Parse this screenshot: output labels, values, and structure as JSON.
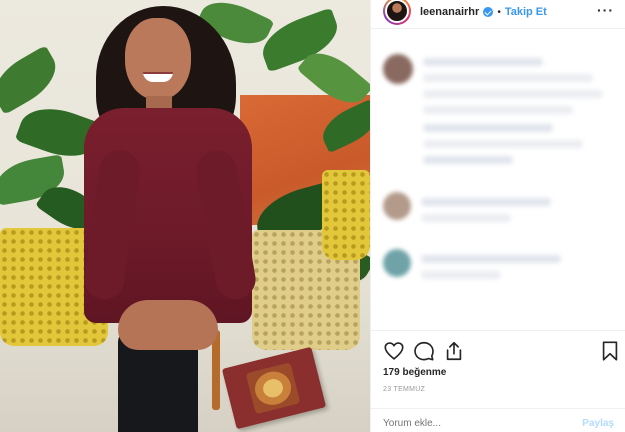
{
  "post": {
    "username": "leenanairhr",
    "verified": true,
    "separator": "•",
    "follow_label": "Takip Et",
    "more_icon": "more-horizontal-icon",
    "likes_text": "179 beğenme",
    "date_text": "23 TEMMUZ",
    "comment_placeholder": "Yorum ekle...",
    "post_label": "Paylaş"
  },
  "actions": [
    {
      "name": "like",
      "icon": "heart-icon"
    },
    {
      "name": "comment",
      "icon": "comment-bubble-icon"
    },
    {
      "name": "share",
      "icon": "share-icon"
    },
    {
      "name": "save",
      "icon": "bookmark-icon"
    }
  ],
  "colors": {
    "accent": "#3897f0",
    "text": "#262626",
    "muted": "#999999",
    "post_disabled": "#b3dbff",
    "dress": "#6d1a29",
    "pot_yellow": "#e2c73a"
  }
}
